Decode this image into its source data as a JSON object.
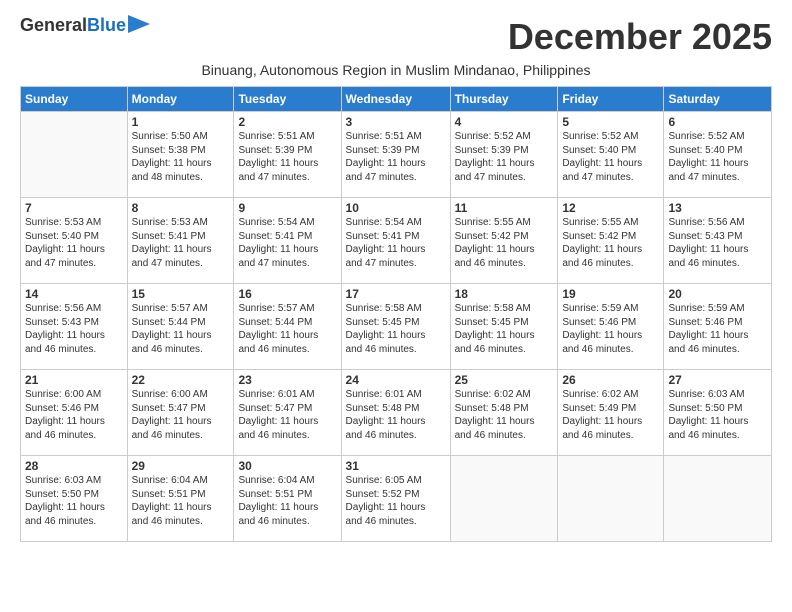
{
  "logo": {
    "line1": "General",
    "line2": "Blue"
  },
  "title": "December 2025",
  "subtitle": "Binuang, Autonomous Region in Muslim Mindanao, Philippines",
  "days_of_week": [
    "Sunday",
    "Monday",
    "Tuesday",
    "Wednesday",
    "Thursday",
    "Friday",
    "Saturday"
  ],
  "weeks": [
    [
      {
        "day": "",
        "info": ""
      },
      {
        "day": "1",
        "info": "Sunrise: 5:50 AM\nSunset: 5:38 PM\nDaylight: 11 hours\nand 48 minutes."
      },
      {
        "day": "2",
        "info": "Sunrise: 5:51 AM\nSunset: 5:39 PM\nDaylight: 11 hours\nand 47 minutes."
      },
      {
        "day": "3",
        "info": "Sunrise: 5:51 AM\nSunset: 5:39 PM\nDaylight: 11 hours\nand 47 minutes."
      },
      {
        "day": "4",
        "info": "Sunrise: 5:52 AM\nSunset: 5:39 PM\nDaylight: 11 hours\nand 47 minutes."
      },
      {
        "day": "5",
        "info": "Sunrise: 5:52 AM\nSunset: 5:40 PM\nDaylight: 11 hours\nand 47 minutes."
      },
      {
        "day": "6",
        "info": "Sunrise: 5:52 AM\nSunset: 5:40 PM\nDaylight: 11 hours\nand 47 minutes."
      }
    ],
    [
      {
        "day": "7",
        "info": "Sunrise: 5:53 AM\nSunset: 5:40 PM\nDaylight: 11 hours\nand 47 minutes."
      },
      {
        "day": "8",
        "info": "Sunrise: 5:53 AM\nSunset: 5:41 PM\nDaylight: 11 hours\nand 47 minutes."
      },
      {
        "day": "9",
        "info": "Sunrise: 5:54 AM\nSunset: 5:41 PM\nDaylight: 11 hours\nand 47 minutes."
      },
      {
        "day": "10",
        "info": "Sunrise: 5:54 AM\nSunset: 5:41 PM\nDaylight: 11 hours\nand 47 minutes."
      },
      {
        "day": "11",
        "info": "Sunrise: 5:55 AM\nSunset: 5:42 PM\nDaylight: 11 hours\nand 46 minutes."
      },
      {
        "day": "12",
        "info": "Sunrise: 5:55 AM\nSunset: 5:42 PM\nDaylight: 11 hours\nand 46 minutes."
      },
      {
        "day": "13",
        "info": "Sunrise: 5:56 AM\nSunset: 5:43 PM\nDaylight: 11 hours\nand 46 minutes."
      }
    ],
    [
      {
        "day": "14",
        "info": "Sunrise: 5:56 AM\nSunset: 5:43 PM\nDaylight: 11 hours\nand 46 minutes."
      },
      {
        "day": "15",
        "info": "Sunrise: 5:57 AM\nSunset: 5:44 PM\nDaylight: 11 hours\nand 46 minutes."
      },
      {
        "day": "16",
        "info": "Sunrise: 5:57 AM\nSunset: 5:44 PM\nDaylight: 11 hours\nand 46 minutes."
      },
      {
        "day": "17",
        "info": "Sunrise: 5:58 AM\nSunset: 5:45 PM\nDaylight: 11 hours\nand 46 minutes."
      },
      {
        "day": "18",
        "info": "Sunrise: 5:58 AM\nSunset: 5:45 PM\nDaylight: 11 hours\nand 46 minutes."
      },
      {
        "day": "19",
        "info": "Sunrise: 5:59 AM\nSunset: 5:46 PM\nDaylight: 11 hours\nand 46 minutes."
      },
      {
        "day": "20",
        "info": "Sunrise: 5:59 AM\nSunset: 5:46 PM\nDaylight: 11 hours\nand 46 minutes."
      }
    ],
    [
      {
        "day": "21",
        "info": "Sunrise: 6:00 AM\nSunset: 5:46 PM\nDaylight: 11 hours\nand 46 minutes."
      },
      {
        "day": "22",
        "info": "Sunrise: 6:00 AM\nSunset: 5:47 PM\nDaylight: 11 hours\nand 46 minutes."
      },
      {
        "day": "23",
        "info": "Sunrise: 6:01 AM\nSunset: 5:47 PM\nDaylight: 11 hours\nand 46 minutes."
      },
      {
        "day": "24",
        "info": "Sunrise: 6:01 AM\nSunset: 5:48 PM\nDaylight: 11 hours\nand 46 minutes."
      },
      {
        "day": "25",
        "info": "Sunrise: 6:02 AM\nSunset: 5:48 PM\nDaylight: 11 hours\nand 46 minutes."
      },
      {
        "day": "26",
        "info": "Sunrise: 6:02 AM\nSunset: 5:49 PM\nDaylight: 11 hours\nand 46 minutes."
      },
      {
        "day": "27",
        "info": "Sunrise: 6:03 AM\nSunset: 5:50 PM\nDaylight: 11 hours\nand 46 minutes."
      }
    ],
    [
      {
        "day": "28",
        "info": "Sunrise: 6:03 AM\nSunset: 5:50 PM\nDaylight: 11 hours\nand 46 minutes."
      },
      {
        "day": "29",
        "info": "Sunrise: 6:04 AM\nSunset: 5:51 PM\nDaylight: 11 hours\nand 46 minutes."
      },
      {
        "day": "30",
        "info": "Sunrise: 6:04 AM\nSunset: 5:51 PM\nDaylight: 11 hours\nand 46 minutes."
      },
      {
        "day": "31",
        "info": "Sunrise: 6:05 AM\nSunset: 5:52 PM\nDaylight: 11 hours\nand 46 minutes."
      },
      {
        "day": "",
        "info": ""
      },
      {
        "day": "",
        "info": ""
      },
      {
        "day": "",
        "info": ""
      }
    ]
  ]
}
